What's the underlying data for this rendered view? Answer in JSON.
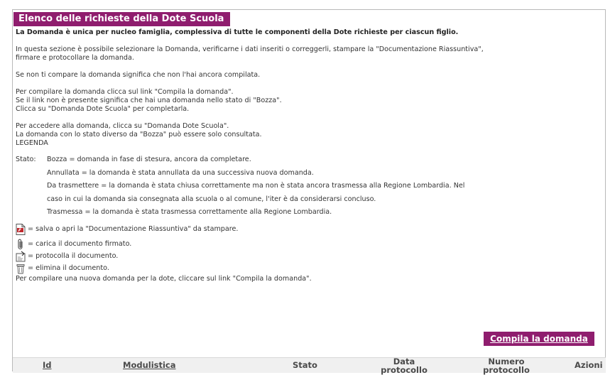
{
  "page": {
    "title": "Elenco delle richieste della Dote Scuola",
    "lead": "La Domanda è unica per nucleo famiglia, complessiva di tutte le componenti della Dote richieste per ciascun figlio.",
    "intro_line1": "In questa sezione è possibile selezionare la Domanda, verificarne i dati inseriti o correggerli, stampare la \"Documentazione Riassuntiva\",",
    "intro_line2": "firmare e protocollare la domanda.",
    "not_found": "Se non ti compare la domanda significa che non l'hai ancora compilata.",
    "compile_line1": "Per compilare la domanda clicca sul link \"Compila la domanda\".",
    "compile_line2": "Se il link non è presente significa che hai una domanda nello stato di \"Bozza\".",
    "compile_line3": "Clicca su \"Domanda Dote Scuola\" per completarla.",
    "access_line1": "Per accedere alla domanda, clicca su \"Domanda Dote Scuola\".",
    "access_line2": "La domanda con lo stato diverso da \"Bozza\" può essere solo consultata.",
    "legend_title": "LEGENDA",
    "stato_label": "Stato:",
    "stati": [
      "Bozza = domanda in fase di stesura, ancora da completare.",
      "Annullata = la domanda è stata annullata da una successiva nuova domanda.",
      "Da trasmettere = la domanda è stata chiusa correttamente ma non è stata ancora trasmessa alla Regione Lombardia. Nel",
      "caso in cui la domanda sia consegnata alla scuola o al comune, l'iter è da considerarsi concluso.",
      "Trasmessa = la domanda è stata trasmessa correttamente alla Regione Lombardia."
    ],
    "icons": {
      "pdf": "= salva o apri la \"Documentazione Riassuntiva\" da stampare.",
      "clip": "= carica il documento firmato.",
      "protocol": "= protocolla il documento.",
      "trash": "= elimina il documento."
    },
    "final_note": "Per compilare una nuova domanda per la dote, cliccare sul link \"Compila la domanda\".",
    "button_label": "Compila la domanda"
  },
  "table": {
    "headers": {
      "id": "Id",
      "modulistica": "Modulistica",
      "stato": "Stato",
      "data_protocollo_1": "Data",
      "data_protocollo_2": "protocollo",
      "numero_protocollo_1": "Numero",
      "numero_protocollo_2": "protocollo",
      "azioni": "Azioni"
    }
  },
  "colors": {
    "accent": "#8f1d6e",
    "border": "#b9b9b9",
    "header_bg": "#f0f0f0"
  }
}
